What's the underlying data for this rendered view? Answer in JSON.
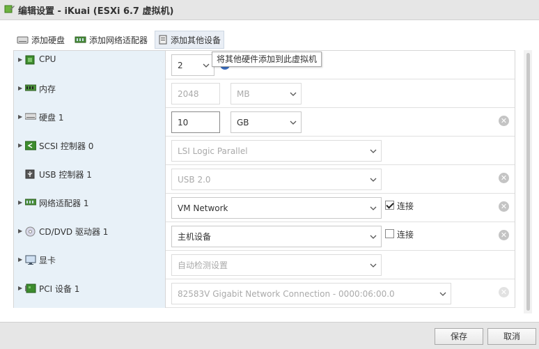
{
  "window": {
    "title": "编辑设置 - iKuai (ESXi 6.7 虚拟机)"
  },
  "toolbar": {
    "add_disk": "添加硬盘",
    "add_nic": "添加网络适配器",
    "add_other": "添加其他设备"
  },
  "tooltip": "将其他硬件添加到此虚拟机",
  "rows": [
    {
      "label": "CPU",
      "value": "2"
    },
    {
      "label": "内存",
      "value": "2048",
      "unit": "MB"
    },
    {
      "label": "硬盘 1",
      "value": "10",
      "unit": "GB"
    },
    {
      "label": "SCSI 控制器 0",
      "value": "LSI Logic Parallel"
    },
    {
      "label": "USB 控制器 1",
      "value": "USB 2.0"
    },
    {
      "label": "网络适配器 1",
      "value": "VM Network",
      "connect_label": "连接",
      "connected": true
    },
    {
      "label": "CD/DVD 驱动器 1",
      "value": "主机设备",
      "connect_label": "连接",
      "connected": false
    },
    {
      "label": "显卡",
      "value": "自动检测设置"
    },
    {
      "label": "PCI 设备 1",
      "value": "82583V Gigabit Network Connection - 0000:06:00.0"
    }
  ],
  "footer": {
    "save": "保存",
    "cancel": "取消"
  },
  "colors": {
    "label_bg": "#e8f1f8",
    "titlebar_bg": "#e6e6e6",
    "accent": "#3b6ebf"
  }
}
